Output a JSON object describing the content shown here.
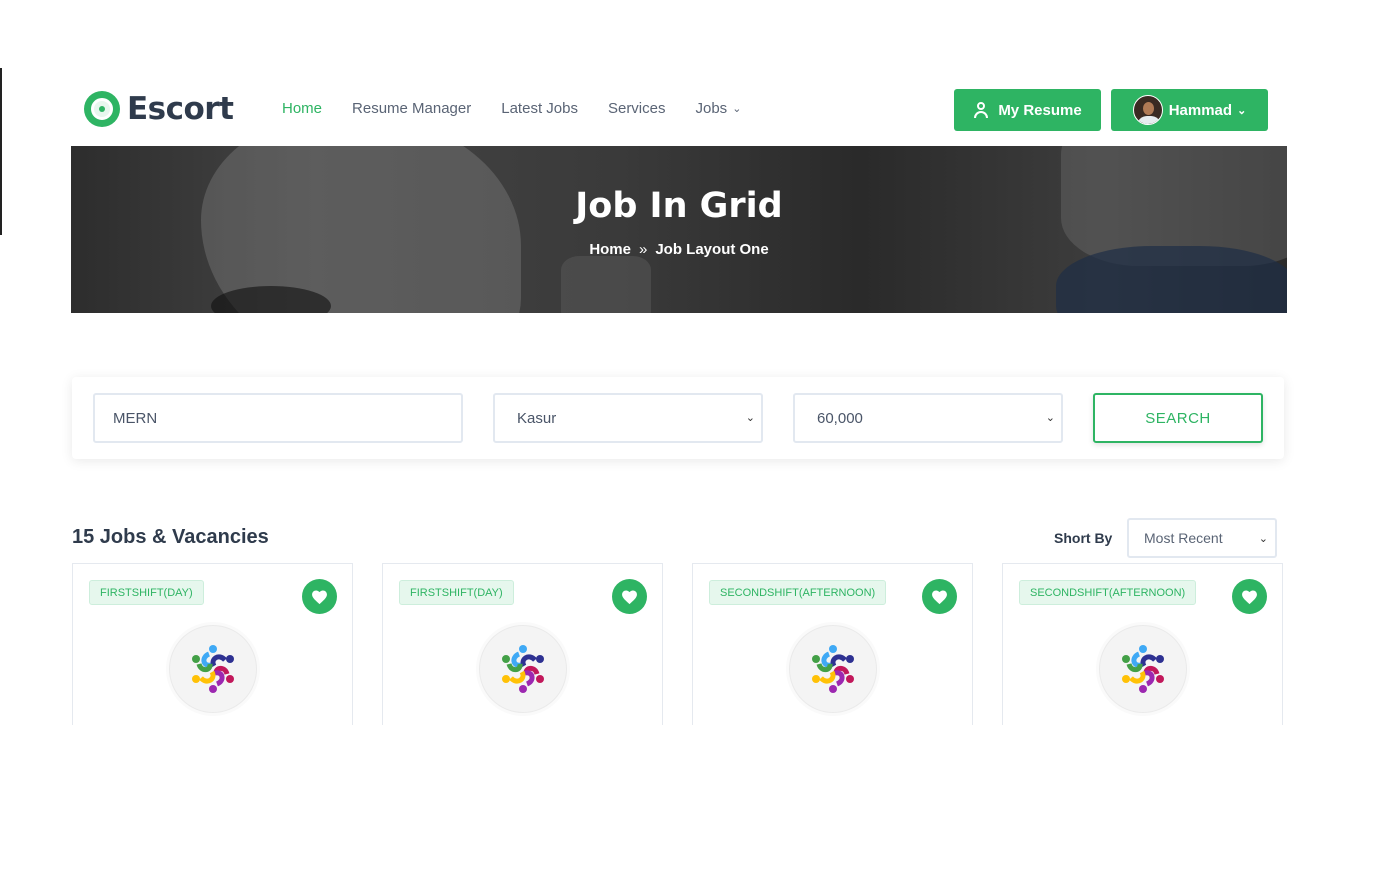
{
  "header": {
    "logo_text": "Escort",
    "nav": [
      {
        "label": "Home",
        "active": true
      },
      {
        "label": "Resume Manager"
      },
      {
        "label": "Latest Jobs"
      },
      {
        "label": "Services"
      },
      {
        "label": "Jobs",
        "has_dropdown": true
      }
    ],
    "resume_button": "My Resume",
    "user_button": "Hammad"
  },
  "banner": {
    "title": "Job In Grid",
    "breadcrumb": [
      "Home",
      "Job Layout One"
    ]
  },
  "search": {
    "keyword": "MERN",
    "location": "Kasur",
    "salary": "60,000",
    "button": "SEARCH"
  },
  "results": {
    "count_label": "15 Jobs & Vacancies",
    "sort_label": "Short By",
    "sort_value": "Most Recent"
  },
  "cards": [
    {
      "shift": "FIRSTSHIFT(DAY)"
    },
    {
      "shift": "FIRSTSHIFT(DAY)"
    },
    {
      "shift": "SECONDSHIFT(AFTERNOON)"
    },
    {
      "shift": "SECONDSHIFT(AFTERNOON)"
    }
  ],
  "colors": {
    "accent": "#2eb463",
    "heading": "#2f3b4c",
    "tag_bg": "#e6f7ed"
  }
}
